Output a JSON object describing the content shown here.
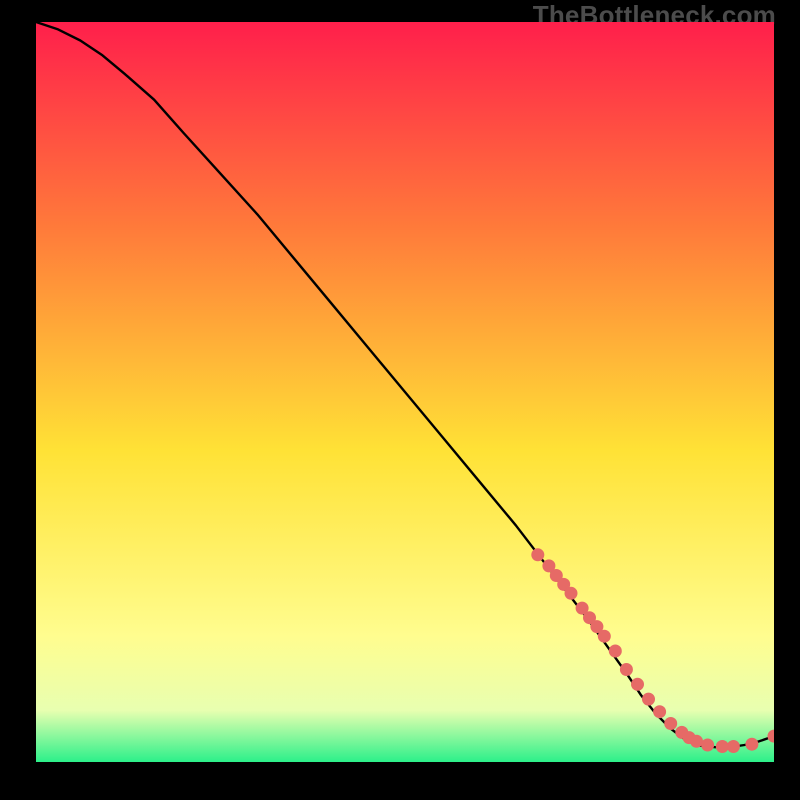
{
  "watermark": "TheBottleneck.com",
  "colors": {
    "gradient_top": "#ff1f4b",
    "gradient_mid_upper": "#ff7b3a",
    "gradient_mid": "#ffe236",
    "gradient_mid_lower": "#fffd8f",
    "gradient_band": "#e8ffb0",
    "gradient_bottom": "#2cf08a",
    "line": "#000000",
    "marker": "#e66a66",
    "background": "#000000"
  },
  "chart_data": {
    "type": "line",
    "title": "",
    "xlabel": "",
    "ylabel": "",
    "xlim": [
      0,
      100
    ],
    "ylim": [
      0,
      100
    ],
    "series": [
      {
        "name": "curve",
        "x": [
          0,
          3,
          6,
          9,
          12,
          16,
          20,
          25,
          30,
          35,
          40,
          45,
          50,
          55,
          60,
          65,
          70,
          75,
          80,
          82,
          84,
          86,
          88,
          90,
          92,
          94,
          96,
          98,
          100
        ],
        "y": [
          100,
          99,
          97.5,
          95.5,
          93,
          89.5,
          85,
          79.5,
          74,
          68,
          62,
          56,
          50,
          44,
          38,
          32,
          25.5,
          19,
          12,
          9,
          6.5,
          4.5,
          3,
          2.2,
          2,
          2,
          2.3,
          2.8,
          3.5
        ]
      }
    ],
    "markers": {
      "name": "highlight-points",
      "x": [
        68,
        69.5,
        70.5,
        71.5,
        72.5,
        74,
        75,
        76,
        77,
        78.5,
        80,
        81.5,
        83,
        84.5,
        86,
        87.5,
        88.5,
        89.5,
        91,
        93,
        94.5,
        97,
        100
      ],
      "y": [
        28,
        26.5,
        25.2,
        24,
        22.8,
        20.8,
        19.5,
        18.3,
        17,
        15,
        12.5,
        10.5,
        8.5,
        6.8,
        5.2,
        4,
        3.3,
        2.8,
        2.3,
        2.1,
        2.1,
        2.4,
        3.5
      ]
    }
  }
}
